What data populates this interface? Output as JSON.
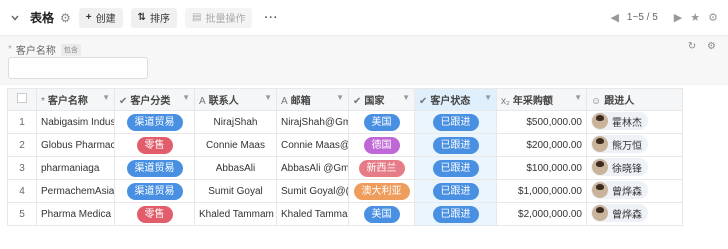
{
  "toolbar": {
    "title": "表格",
    "create_label": "创建",
    "sort_label": "排序",
    "batch_label": "批量操作",
    "more_label": "···",
    "pager_text": "1~5 / 5"
  },
  "filter": {
    "label": "客户名称",
    "tag": "包含",
    "value": ""
  },
  "table": {
    "headers": {
      "name": "客户名称",
      "category": "客户分类",
      "contact": "联系人",
      "email": "邮箱",
      "country": "国家",
      "status": "客户状态",
      "amount": "年采购额",
      "follower": "跟进人"
    },
    "header_icons": {
      "name": "*",
      "category": "✔",
      "contact": "A",
      "email": "A",
      "country": "✔",
      "status": "✔",
      "amount": "x₂",
      "follower": "☺"
    },
    "rows": [
      {
        "idx": "1",
        "name": "Nabigasim Indus",
        "category": "渠道贸易",
        "category_color": "#4a90e2",
        "contact": "NirajShah",
        "email": "NirajShah@Gm",
        "country": "美国",
        "country_color": "#4a90e2",
        "status": "已跟进",
        "amount": "$500,000.00",
        "follower": "霍林杰"
      },
      {
        "idx": "2",
        "name": "Globus Pharmac",
        "category": "零售",
        "category_color": "#e25d6b",
        "contact": "Connie Maas",
        "email": "Connie Maas@",
        "country": "德国",
        "country_color": "#c067d6",
        "status": "已跟进",
        "amount": "$200,000.00",
        "follower": "熊万恒"
      },
      {
        "idx": "3",
        "name": "pharmaniaga",
        "category": "渠道贸易",
        "category_color": "#4a90e2",
        "contact": "AbbasAli",
        "email": "AbbasAli @Gm",
        "country": "新西兰",
        "country_color": "#e57c87",
        "status": "已跟进",
        "amount": "$100,000.00",
        "follower": "徐晓锋"
      },
      {
        "idx": "4",
        "name": "PermachemAsia",
        "category": "渠道贸易",
        "category_color": "#4a90e2",
        "contact": "Sumit Goyal",
        "email": "Sumit Goyal@(",
        "country": "澳大利亚",
        "country_color": "#ee9d5c",
        "status": "已跟进",
        "amount": "$1,000,000.00",
        "follower": "曾烨森"
      },
      {
        "idx": "5",
        "name": "Pharma Medica",
        "category": "零售",
        "category_color": "#e25d6b",
        "contact": "Khaled Tammam",
        "email": "Khaled Tamma",
        "country": "美国",
        "country_color": "#4a90e2",
        "status": "已跟进",
        "amount": "$2,000,000.00",
        "follower": "曾烨森"
      }
    ],
    "status_color": "#4a90e2"
  }
}
